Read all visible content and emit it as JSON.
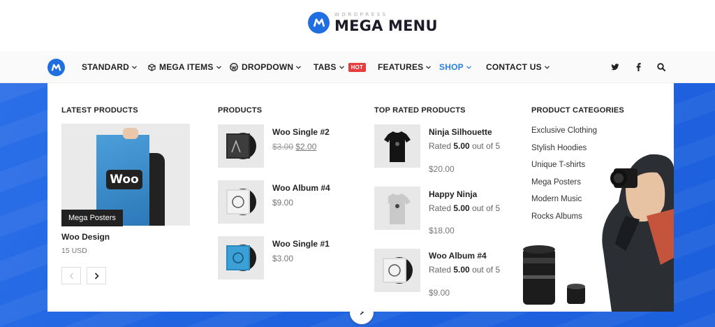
{
  "logo": {
    "small": "WORDPRESS",
    "big": "MEGA MENU"
  },
  "nav": {
    "items": [
      {
        "label": "STANDARD",
        "icon": "",
        "chevron": true
      },
      {
        "label": "MEGA ITEMS",
        "icon": "cube-icon",
        "chevron": true
      },
      {
        "label": "DROPDOWN",
        "icon": "wordpress-icon",
        "chevron": true
      },
      {
        "label": "TABS",
        "icon": "",
        "chevron": true,
        "badge": "HOT"
      },
      {
        "label": "FEATURES",
        "icon": "",
        "chevron": true
      },
      {
        "label": "SHOP",
        "icon": "",
        "chevron": true,
        "active": true
      },
      {
        "label": "CONTACT US",
        "icon": "",
        "chevron": true
      }
    ],
    "social": [
      "twitter-icon",
      "facebook-icon",
      "search-icon"
    ]
  },
  "mega": {
    "latest": {
      "title": "LATEST PRODUCTS",
      "category_label": "Mega Posters",
      "name": "Woo Design",
      "price": "15 USD",
      "poster_text": "Woo"
    },
    "products": {
      "title": "PRODUCTS",
      "items": [
        {
          "name": "Woo Single #2",
          "old_price": "$3.00",
          "price": "$2.00"
        },
        {
          "name": "Woo Album #4",
          "price": "$9.00"
        },
        {
          "name": "Woo Single #1",
          "price": "$3.00"
        }
      ]
    },
    "top_rated": {
      "title": "TOP RATED PRODUCTS",
      "items": [
        {
          "name": "Ninja Silhouette",
          "rated_prefix": "Rated",
          "rating": "5.00",
          "rated_suffix": "out of",
          "rated_max": "5",
          "price": "$20.00"
        },
        {
          "name": "Happy Ninja",
          "rated_prefix": "Rated",
          "rating": "5.00",
          "rated_suffix": "out of",
          "rated_max": "5",
          "price": "$18.00"
        },
        {
          "name": "Woo Album #4",
          "rated_prefix": "Rated",
          "rating": "5.00",
          "rated_suffix": "out of",
          "rated_max": "5",
          "price": "$9.00"
        }
      ]
    },
    "categories": {
      "title": "PRODUCT CATEGORIES",
      "items": [
        "Exclusive Clothing",
        "Stylish Hoodies",
        "Unique T-shirts",
        "Mega Posters",
        "Modern Music",
        "Rocks Albums"
      ]
    }
  },
  "colors": {
    "brand_blue": "#1f6fe0",
    "active_nav": "#2a7de1",
    "hot_badge": "#e83d3d"
  }
}
